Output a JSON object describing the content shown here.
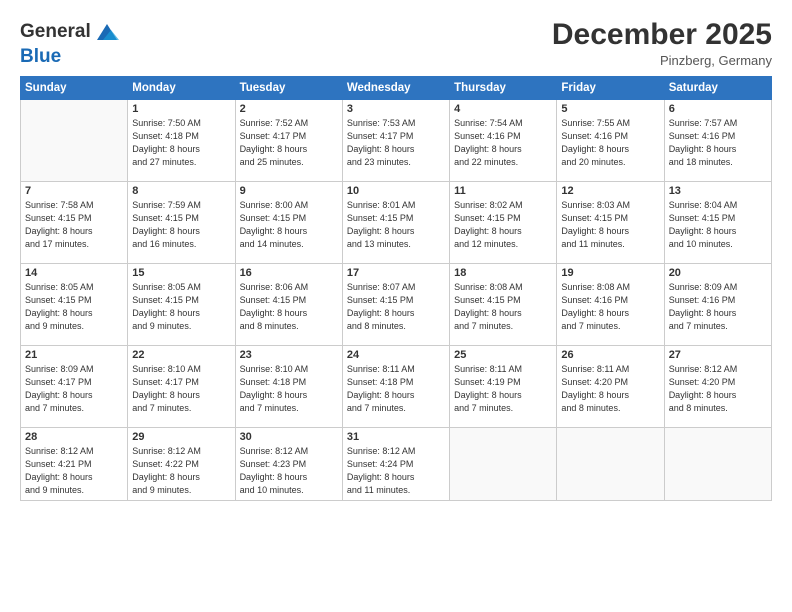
{
  "header": {
    "logo_general": "General",
    "logo_blue": "Blue",
    "month": "December 2025",
    "location": "Pinzberg, Germany"
  },
  "days": [
    "Sunday",
    "Monday",
    "Tuesday",
    "Wednesday",
    "Thursday",
    "Friday",
    "Saturday"
  ],
  "weeks": [
    [
      {
        "day": "",
        "info": ""
      },
      {
        "day": "1",
        "info": "Sunrise: 7:50 AM\nSunset: 4:18 PM\nDaylight: 8 hours\nand 27 minutes."
      },
      {
        "day": "2",
        "info": "Sunrise: 7:52 AM\nSunset: 4:17 PM\nDaylight: 8 hours\nand 25 minutes."
      },
      {
        "day": "3",
        "info": "Sunrise: 7:53 AM\nSunset: 4:17 PM\nDaylight: 8 hours\nand 23 minutes."
      },
      {
        "day": "4",
        "info": "Sunrise: 7:54 AM\nSunset: 4:16 PM\nDaylight: 8 hours\nand 22 minutes."
      },
      {
        "day": "5",
        "info": "Sunrise: 7:55 AM\nSunset: 4:16 PM\nDaylight: 8 hours\nand 20 minutes."
      },
      {
        "day": "6",
        "info": "Sunrise: 7:57 AM\nSunset: 4:16 PM\nDaylight: 8 hours\nand 18 minutes."
      }
    ],
    [
      {
        "day": "7",
        "info": "Sunrise: 7:58 AM\nSunset: 4:15 PM\nDaylight: 8 hours\nand 17 minutes."
      },
      {
        "day": "8",
        "info": "Sunrise: 7:59 AM\nSunset: 4:15 PM\nDaylight: 8 hours\nand 16 minutes."
      },
      {
        "day": "9",
        "info": "Sunrise: 8:00 AM\nSunset: 4:15 PM\nDaylight: 8 hours\nand 14 minutes."
      },
      {
        "day": "10",
        "info": "Sunrise: 8:01 AM\nSunset: 4:15 PM\nDaylight: 8 hours\nand 13 minutes."
      },
      {
        "day": "11",
        "info": "Sunrise: 8:02 AM\nSunset: 4:15 PM\nDaylight: 8 hours\nand 12 minutes."
      },
      {
        "day": "12",
        "info": "Sunrise: 8:03 AM\nSunset: 4:15 PM\nDaylight: 8 hours\nand 11 minutes."
      },
      {
        "day": "13",
        "info": "Sunrise: 8:04 AM\nSunset: 4:15 PM\nDaylight: 8 hours\nand 10 minutes."
      }
    ],
    [
      {
        "day": "14",
        "info": "Sunrise: 8:05 AM\nSunset: 4:15 PM\nDaylight: 8 hours\nand 9 minutes."
      },
      {
        "day": "15",
        "info": "Sunrise: 8:05 AM\nSunset: 4:15 PM\nDaylight: 8 hours\nand 9 minutes."
      },
      {
        "day": "16",
        "info": "Sunrise: 8:06 AM\nSunset: 4:15 PM\nDaylight: 8 hours\nand 8 minutes."
      },
      {
        "day": "17",
        "info": "Sunrise: 8:07 AM\nSunset: 4:15 PM\nDaylight: 8 hours\nand 8 minutes."
      },
      {
        "day": "18",
        "info": "Sunrise: 8:08 AM\nSunset: 4:15 PM\nDaylight: 8 hours\nand 7 minutes."
      },
      {
        "day": "19",
        "info": "Sunrise: 8:08 AM\nSunset: 4:16 PM\nDaylight: 8 hours\nand 7 minutes."
      },
      {
        "day": "20",
        "info": "Sunrise: 8:09 AM\nSunset: 4:16 PM\nDaylight: 8 hours\nand 7 minutes."
      }
    ],
    [
      {
        "day": "21",
        "info": "Sunrise: 8:09 AM\nSunset: 4:17 PM\nDaylight: 8 hours\nand 7 minutes."
      },
      {
        "day": "22",
        "info": "Sunrise: 8:10 AM\nSunset: 4:17 PM\nDaylight: 8 hours\nand 7 minutes."
      },
      {
        "day": "23",
        "info": "Sunrise: 8:10 AM\nSunset: 4:18 PM\nDaylight: 8 hours\nand 7 minutes."
      },
      {
        "day": "24",
        "info": "Sunrise: 8:11 AM\nSunset: 4:18 PM\nDaylight: 8 hours\nand 7 minutes."
      },
      {
        "day": "25",
        "info": "Sunrise: 8:11 AM\nSunset: 4:19 PM\nDaylight: 8 hours\nand 7 minutes."
      },
      {
        "day": "26",
        "info": "Sunrise: 8:11 AM\nSunset: 4:20 PM\nDaylight: 8 hours\nand 8 minutes."
      },
      {
        "day": "27",
        "info": "Sunrise: 8:12 AM\nSunset: 4:20 PM\nDaylight: 8 hours\nand 8 minutes."
      }
    ],
    [
      {
        "day": "28",
        "info": "Sunrise: 8:12 AM\nSunset: 4:21 PM\nDaylight: 8 hours\nand 9 minutes."
      },
      {
        "day": "29",
        "info": "Sunrise: 8:12 AM\nSunset: 4:22 PM\nDaylight: 8 hours\nand 9 minutes."
      },
      {
        "day": "30",
        "info": "Sunrise: 8:12 AM\nSunset: 4:23 PM\nDaylight: 8 hours\nand 10 minutes."
      },
      {
        "day": "31",
        "info": "Sunrise: 8:12 AM\nSunset: 4:24 PM\nDaylight: 8 hours\nand 11 minutes."
      },
      {
        "day": "",
        "info": ""
      },
      {
        "day": "",
        "info": ""
      },
      {
        "day": "",
        "info": ""
      }
    ]
  ]
}
